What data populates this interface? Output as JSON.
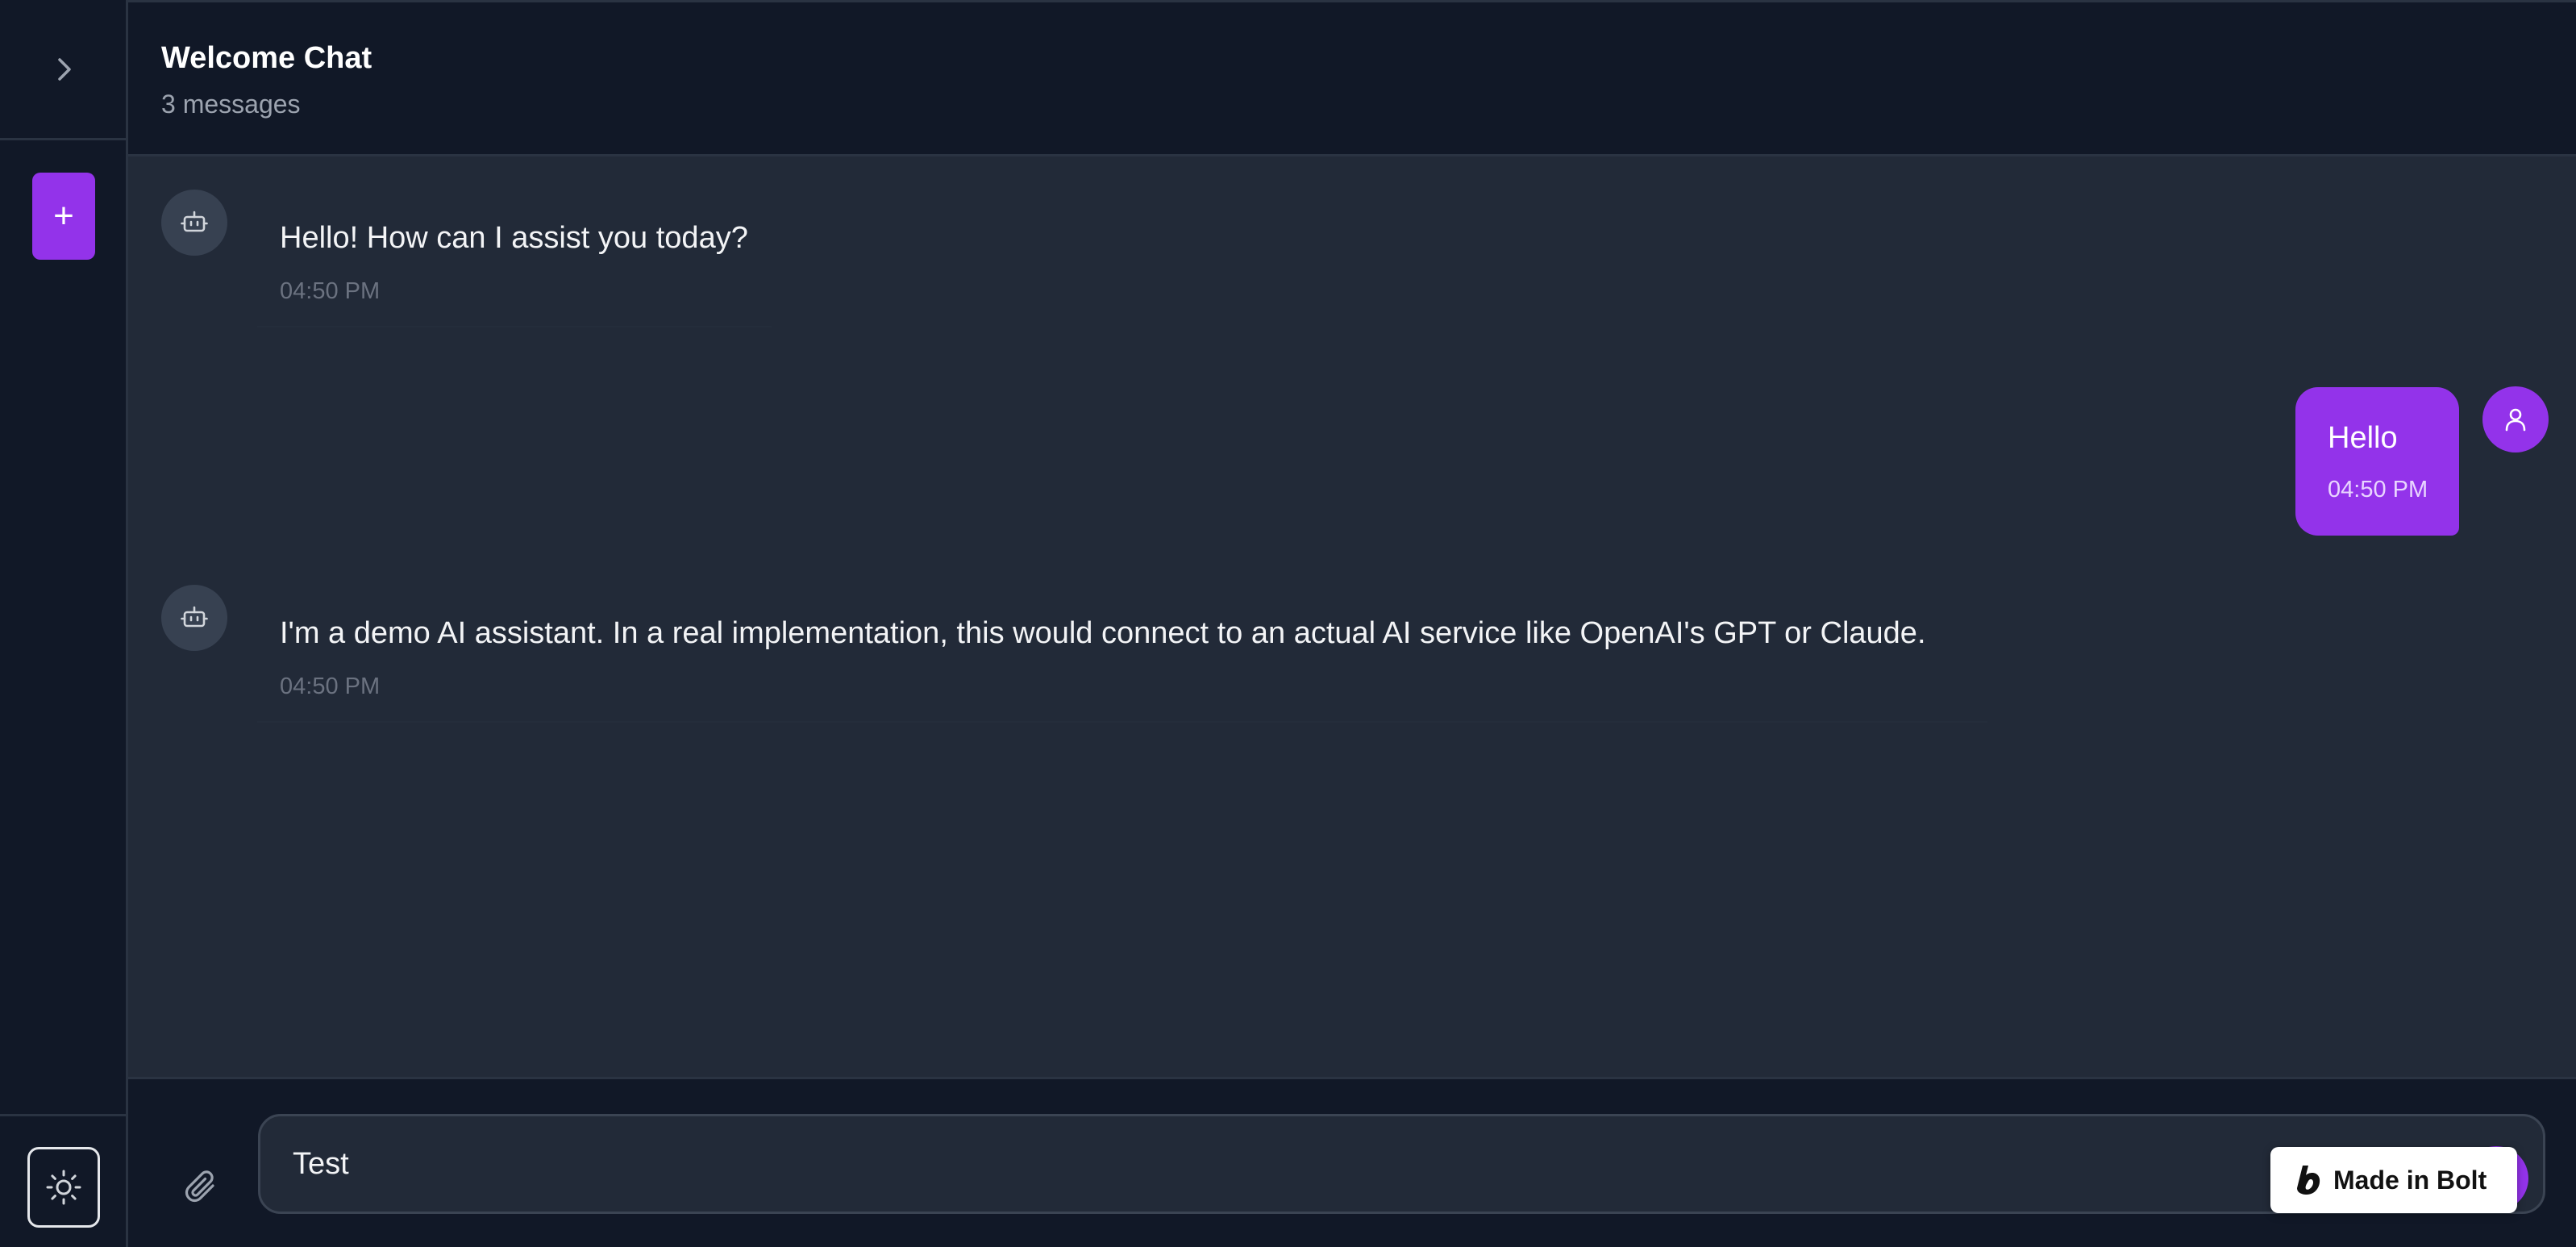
{
  "colors": {
    "accent": "#9333ea",
    "background": "#222a38",
    "panel": "#111827"
  },
  "sidebar": {
    "expand_icon": "chevron-right-icon",
    "new_chat_label": "+",
    "theme_icon": "sun-icon"
  },
  "header": {
    "title": "Welcome Chat",
    "subtitle": "3 messages"
  },
  "messages": [
    {
      "role": "assistant",
      "avatar_icon": "bot-icon",
      "text": "Hello! How can I assist you today?",
      "time": "04:50 PM"
    },
    {
      "role": "user",
      "avatar_icon": "user-icon",
      "text": "Hello",
      "time": "04:50 PM"
    },
    {
      "role": "assistant",
      "avatar_icon": "bot-icon",
      "text": "I'm a demo AI assistant. In a real implementation, this would connect to an actual AI service like OpenAI's GPT or Claude.",
      "time": "04:50 PM"
    }
  ],
  "composer": {
    "attach_icon": "paperclip-icon",
    "input_value": "Test"
  },
  "badge": {
    "label": "Made in Bolt",
    "icon": "bolt-logo"
  }
}
